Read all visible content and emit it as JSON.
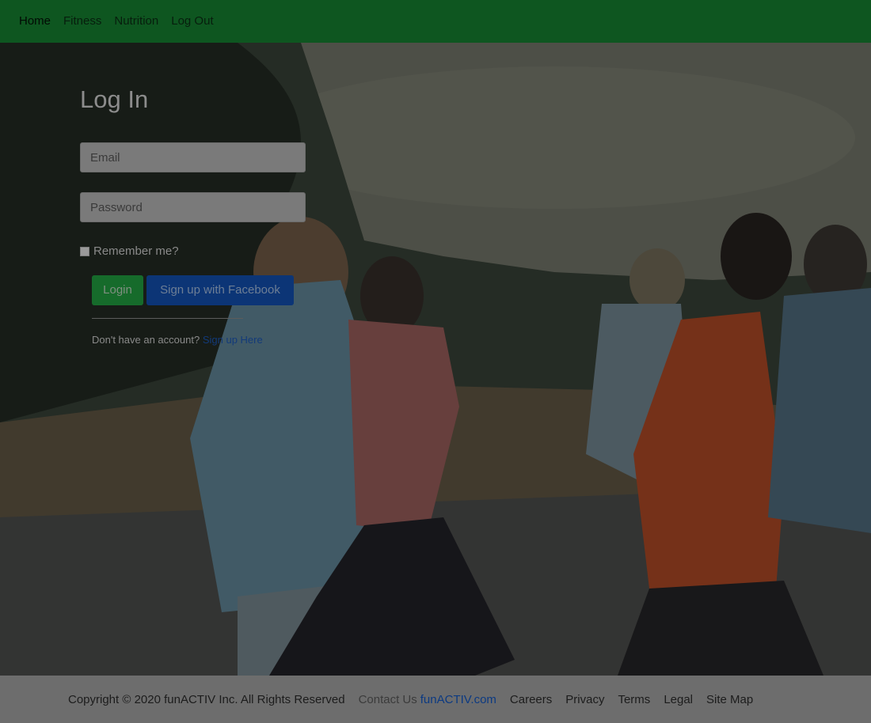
{
  "nav": {
    "items": [
      "Home",
      "Fitness",
      "Nutrition",
      "Log Out"
    ]
  },
  "login": {
    "title": "Log In",
    "email_placeholder": "Email",
    "password_placeholder": "Password",
    "remember_label": "Remember me?",
    "login_button": "Login",
    "facebook_button": "Sign up with Facebook",
    "no_account_text": "Don't have an account?",
    "signup_link": "Sign up Here"
  },
  "footer": {
    "copyright": "Copyright © 2020 funACTIV Inc. All Rights Reserved",
    "contact_prefix": "Contact Us",
    "contact_link": "funACTIV.com",
    "links": [
      "Careers",
      "Privacy",
      "Terms",
      "Legal",
      "Site Map"
    ]
  },
  "colors": {
    "nav_bg": "#0e5620",
    "login_button": "#166b2b",
    "facebook_button": "#0c3576",
    "footer_bg": "#6d6d6d"
  }
}
